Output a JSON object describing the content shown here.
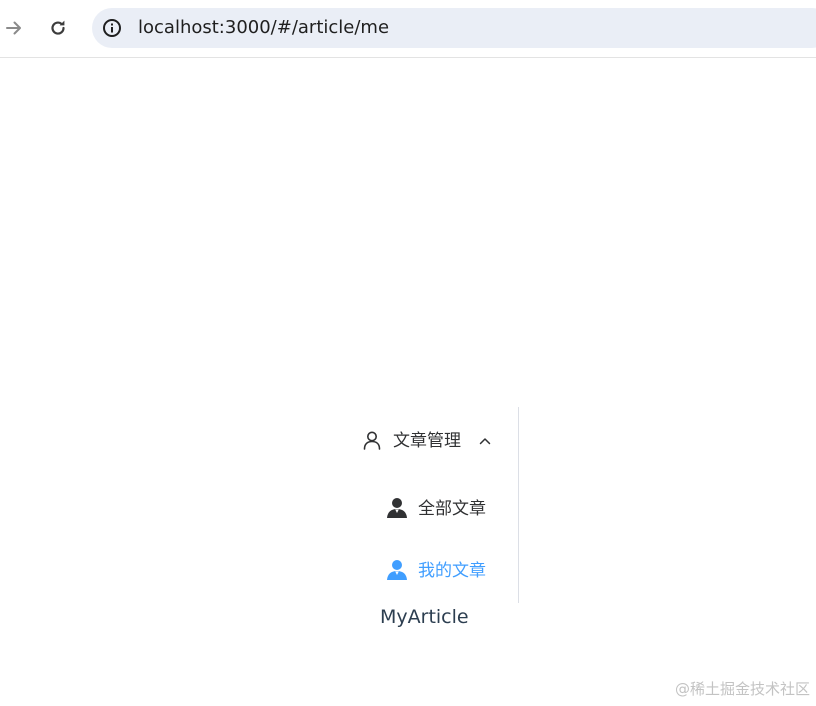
{
  "browser": {
    "url": "localhost:3000/#/article/me",
    "icons": {
      "forward": "arrow-right-icon",
      "reload": "reload-icon",
      "site_info": "info-circle-icon"
    }
  },
  "menu": {
    "submenu_title": "文章管理",
    "submenu_icon": "user-outline-icon",
    "submenu_arrow": "chevron-up-icon",
    "items": [
      {
        "label": "全部文章",
        "icon": "user-solid-icon",
        "active": false
      },
      {
        "label": "我的文章",
        "icon": "user-solid-icon",
        "active": true
      }
    ],
    "colors": {
      "text": "#303133",
      "active": "#409eff",
      "border": "#dcdfe6"
    }
  },
  "main": {
    "content": "MyArticle"
  },
  "watermark": "@稀土掘金技术社区"
}
